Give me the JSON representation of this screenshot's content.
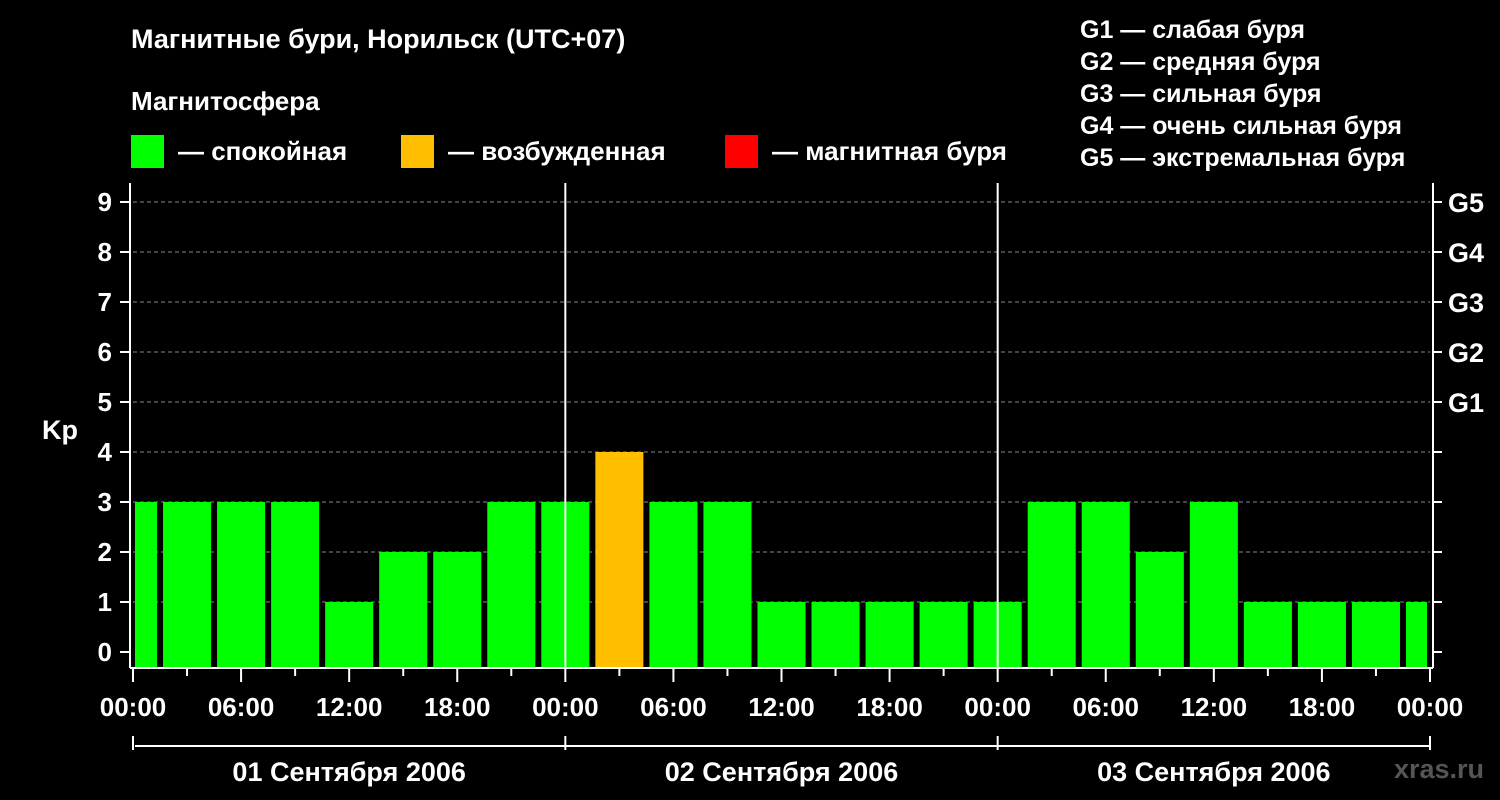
{
  "header": {
    "title": "Магнитные бури, Норильск (UTC+07)",
    "subtitle": "Магнитосфера"
  },
  "legend": [
    {
      "label": "— спокойная",
      "color": "#00ff00"
    },
    {
      "label": "— возбужденная",
      "color": "#ffbf00"
    },
    {
      "label": "— магнитная буря",
      "color": "#ff0000"
    }
  ],
  "g_legend": [
    "G1 — слабая буря",
    "G2 — средняя буря",
    "G3 — сильная буря",
    "G4 — очень сильная буря",
    "G5 — экстремальная буря"
  ],
  "credit": "xras.ru",
  "chart_data": {
    "type": "bar",
    "ylabel": "Kp",
    "ylim": [
      0,
      9
    ],
    "y_ticks": [
      "0",
      "1",
      "2",
      "3",
      "4",
      "5",
      "6",
      "7",
      "8",
      "9"
    ],
    "right_ticks": [
      {
        "value": 5,
        "label": "G1"
      },
      {
        "value": 6,
        "label": "G2"
      },
      {
        "value": 7,
        "label": "G3"
      },
      {
        "value": 8,
        "label": "G4"
      },
      {
        "value": 9,
        "label": "G5"
      }
    ],
    "x_tick_labels": [
      "00:00",
      "06:00",
      "12:00",
      "18:00",
      "00:00",
      "06:00",
      "12:00",
      "18:00",
      "00:00",
      "06:00",
      "12:00",
      "18:00",
      "00:00"
    ],
    "days": [
      "01 Сентября 2006",
      "02 Сентября 2006",
      "03 Сентября 2006"
    ],
    "bars": [
      {
        "hour": 0,
        "kp": 3,
        "color": "#00ff00"
      },
      {
        "hour": 3,
        "kp": 3,
        "color": "#00ff00"
      },
      {
        "hour": 6,
        "kp": 3,
        "color": "#00ff00"
      },
      {
        "hour": 9,
        "kp": 3,
        "color": "#00ff00"
      },
      {
        "hour": 12,
        "kp": 1,
        "color": "#00ff00"
      },
      {
        "hour": 15,
        "kp": 2,
        "color": "#00ff00"
      },
      {
        "hour": 18,
        "kp": 2,
        "color": "#00ff00"
      },
      {
        "hour": 21,
        "kp": 3,
        "color": "#00ff00"
      },
      {
        "hour": 24,
        "kp": 3,
        "color": "#00ff00"
      },
      {
        "hour": 27,
        "kp": 4,
        "color": "#ffbf00"
      },
      {
        "hour": 30,
        "kp": 3,
        "color": "#00ff00"
      },
      {
        "hour": 33,
        "kp": 3,
        "color": "#00ff00"
      },
      {
        "hour": 36,
        "kp": 1,
        "color": "#00ff00"
      },
      {
        "hour": 39,
        "kp": 1,
        "color": "#00ff00"
      },
      {
        "hour": 42,
        "kp": 1,
        "color": "#00ff00"
      },
      {
        "hour": 45,
        "kp": 1,
        "color": "#00ff00"
      },
      {
        "hour": 48,
        "kp": 1,
        "color": "#00ff00"
      },
      {
        "hour": 51,
        "kp": 3,
        "color": "#00ff00"
      },
      {
        "hour": 54,
        "kp": 3,
        "color": "#00ff00"
      },
      {
        "hour": 57,
        "kp": 2,
        "color": "#00ff00"
      },
      {
        "hour": 60,
        "kp": 3,
        "color": "#00ff00"
      },
      {
        "hour": 63,
        "kp": 1,
        "color": "#00ff00"
      },
      {
        "hour": 66,
        "kp": 1,
        "color": "#00ff00"
      },
      {
        "hour": 69,
        "kp": 1,
        "color": "#00ff00"
      },
      {
        "hour": 72,
        "kp": 1,
        "color": "#00ff00"
      }
    ],
    "grid": true,
    "legend_position": "top"
  }
}
